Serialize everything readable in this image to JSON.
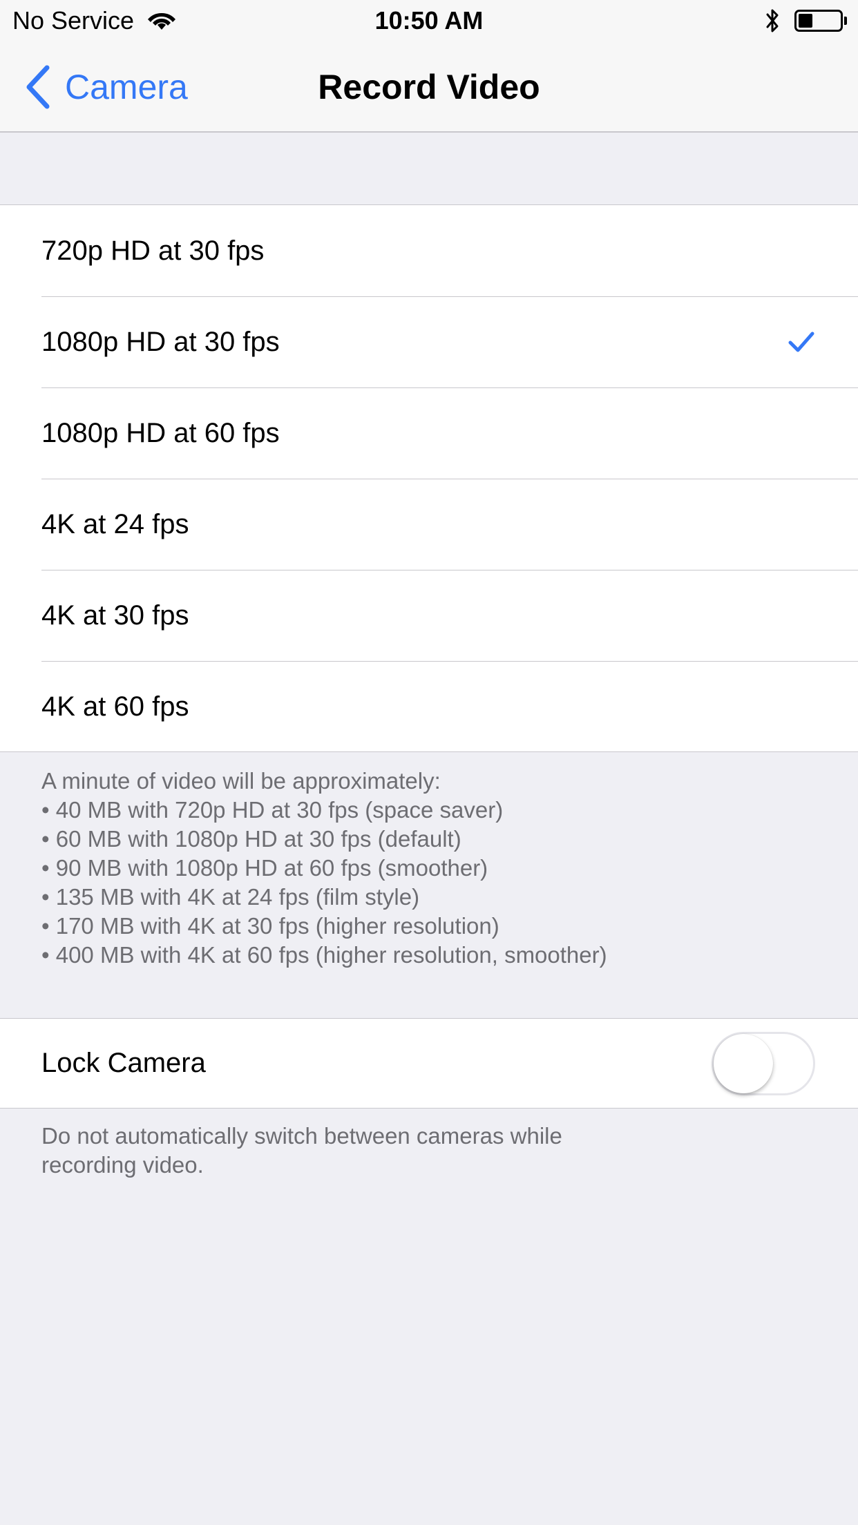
{
  "status_bar": {
    "carrier": "No Service",
    "time": "10:50 AM",
    "wifi_icon": "wifi-icon",
    "bluetooth_icon": "bluetooth-icon",
    "battery_icon": "battery-icon",
    "battery_level": 0.35
  },
  "nav": {
    "back_label": "Camera",
    "back_icon": "chevron-left-icon",
    "title": "Record Video"
  },
  "formats": {
    "options": [
      {
        "label": "720p HD at 30 fps",
        "selected": false
      },
      {
        "label": "1080p HD at 30 fps",
        "selected": true
      },
      {
        "label": "1080p HD at 60 fps",
        "selected": false
      },
      {
        "label": "4K at 24 fps",
        "selected": false
      },
      {
        "label": "4K at 30 fps",
        "selected": false
      },
      {
        "label": "4K at 60 fps",
        "selected": false
      }
    ],
    "check_icon": "checkmark-icon",
    "footer": {
      "intro": "A minute of video will be approximately:",
      "lines": [
        "• 40 MB with 720p HD at 30 fps (space saver)",
        "• 60 MB with 1080p HD at 30 fps (default)",
        "• 90 MB with 1080p HD at 60 fps (smoother)",
        "• 135 MB with 4K at 24 fps (film style)",
        "• 170 MB with 4K at 30 fps (higher resolution)",
        "• 400 MB with 4K at 60 fps (higher resolution, smoother)"
      ]
    }
  },
  "lock_camera": {
    "label": "Lock Camera",
    "enabled": false,
    "footer_line1": "Do not automatically switch between cameras while",
    "footer_line2": "recording video."
  },
  "colors": {
    "accent": "#3478F6",
    "background": "#EFEFF4",
    "separator": "#C8C7CC",
    "footer_text": "#6D6D72"
  }
}
